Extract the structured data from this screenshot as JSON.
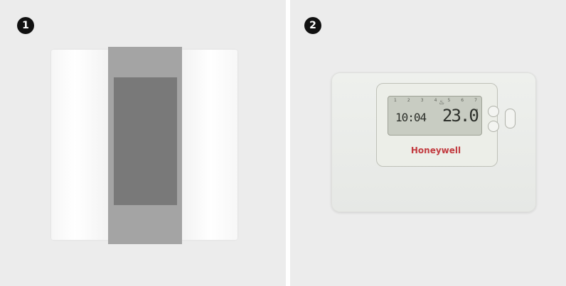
{
  "panels": [
    {
      "badge": "1"
    },
    {
      "badge": "2"
    }
  ],
  "thermostat_2": {
    "days": [
      "1",
      "2",
      "3",
      "4",
      "5",
      "6",
      "7"
    ],
    "time": "10:04",
    "temperature": "23.0",
    "degree_mark": "°",
    "brand": "Honeywell",
    "flame": "♨"
  },
  "colors": {
    "panel_bg": "#ececec",
    "brand_red": "#c23a3f",
    "lcd_bg": "#c8ccc2"
  }
}
